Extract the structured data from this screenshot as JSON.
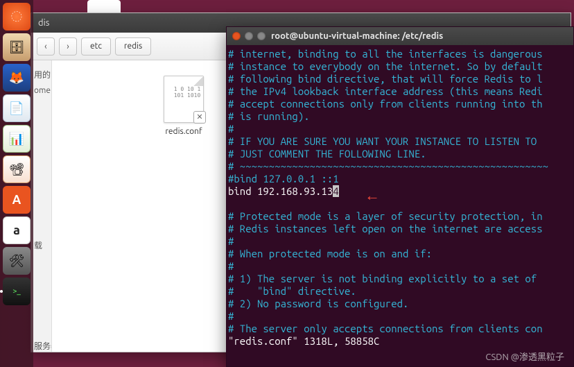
{
  "launcher": {
    "items": [
      {
        "name": "ubuntu-dash",
        "icon": "◌"
      },
      {
        "name": "files",
        "icon": "🗄"
      },
      {
        "name": "firefox",
        "icon": "🦊"
      },
      {
        "name": "libreoffice-writer",
        "icon": "📄"
      },
      {
        "name": "libreoffice-calc",
        "icon": "📊"
      },
      {
        "name": "libreoffice-impress",
        "icon": "📽"
      },
      {
        "name": "ubuntu-software",
        "icon": "A"
      },
      {
        "name": "amazon",
        "icon": "a"
      },
      {
        "name": "system-settings",
        "icon": "🛠"
      },
      {
        "name": "terminal",
        "icon": ">_"
      }
    ]
  },
  "nautilus": {
    "title": "dis",
    "back_icon": "‹",
    "fwd_icon": "›",
    "crumbs": [
      "etc",
      "redis"
    ],
    "sidebar": [
      "用的",
      "ome",
      "载",
      "服务器"
    ],
    "file": {
      "name": "redis.conf",
      "bits": "1 0\n10 1\n101\n1010",
      "badge": "✕"
    }
  },
  "terminal": {
    "title": "root@ubuntu-virtual-machine: /etc/redis",
    "lines": [
      {
        "c": "c-comment",
        "t": "# internet, binding to all the interfaces is dangerous"
      },
      {
        "c": "c-comment",
        "t": "# instance to everybody on the internet. So by default"
      },
      {
        "c": "c-comment",
        "t": "# following bind directive, that will force Redis to l"
      },
      {
        "c": "c-comment",
        "t": "# the IPv4 lookback interface address (this means Redi"
      },
      {
        "c": "c-comment",
        "t": "# accept connections only from clients running into th"
      },
      {
        "c": "c-comment",
        "t": "# is running)."
      },
      {
        "c": "c-comment",
        "t": "#"
      },
      {
        "c": "c-comment",
        "t": "# IF YOU ARE SURE YOU WANT YOUR INSTANCE TO LISTEN TO "
      },
      {
        "c": "c-comment",
        "t": "# JUST COMMENT THE FOLLOWING LINE."
      },
      {
        "c": "c-comment",
        "t": "# ~~~~~~~~~~~~~~~~~~~~~~~~~~~~~~~~~~~~~~~~~~~~~~~~~~~~~"
      },
      {
        "c": "c-comment",
        "t": "#bind 127.0.0.1 ::1"
      }
    ],
    "bind_line": {
      "prefix": "bind 192.168.93.13",
      "cursor": "4"
    },
    "lines2": [
      {
        "c": "c-comment",
        "t": ""
      },
      {
        "c": "c-comment",
        "t": "# Protected mode is a layer of security protection, in"
      },
      {
        "c": "c-comment",
        "t": "# Redis instances left open on the internet are access"
      },
      {
        "c": "c-comment",
        "t": "#"
      },
      {
        "c": "c-comment",
        "t": "# When protected mode is on and if:"
      },
      {
        "c": "c-comment",
        "t": "#"
      },
      {
        "c": "c-comment",
        "t": "# 1) The server is not binding explicitly to a set of "
      },
      {
        "c": "c-comment",
        "t": "#    \"bind\" directive."
      },
      {
        "c": "c-comment",
        "t": "# 2) No password is configured."
      },
      {
        "c": "c-comment",
        "t": "#"
      },
      {
        "c": "c-comment",
        "t": "# The server only accepts connections from clients con"
      }
    ],
    "status": "\"redis.conf\" 1318L, 58858C"
  },
  "arrow": "←",
  "watermark": "CSDN @渗透黑粒子"
}
